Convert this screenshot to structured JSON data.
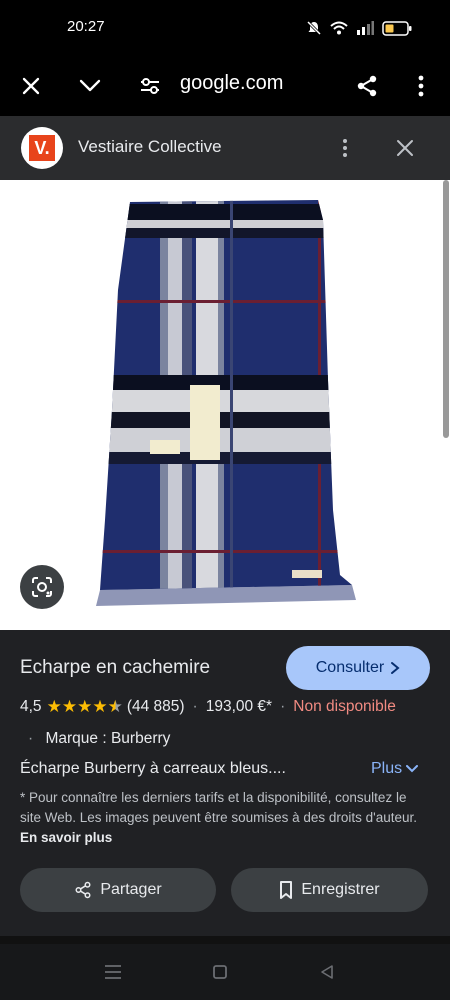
{
  "status_bar": {
    "time": "20:27",
    "icons": [
      "mute-icon",
      "wifi-icon",
      "signal-icon",
      "battery-icon"
    ],
    "battery_color": "#f9c74f"
  },
  "browser": {
    "url": "google.com",
    "icons": [
      "close-icon",
      "chevron-down-icon",
      "site-settings-icon",
      "share-icon",
      "more-vert-icon"
    ]
  },
  "site": {
    "logo_letter": "V.",
    "name": "Vestiaire Collective",
    "icons": [
      "more-vert-icon",
      "close-icon"
    ]
  },
  "image": {
    "lens_icon": "google-lens-icon"
  },
  "product": {
    "title": "Echarpe en cachemire",
    "consult_label": "Consulter",
    "rating": "4,5",
    "stars": 4.5,
    "reviews": "(44 885)",
    "price": "193,00 €*",
    "availability": "Non disponible",
    "brand": "Marque : Burberry",
    "description": "Écharpe Burberry à carreaux bleus....",
    "more_label": "Plus",
    "disclaimer": "* Pour connaître les derniers tarifs et la disponibilité, consultez le site Web. Les images peuvent être soumises à des droits d'auteur.",
    "learn_more": "En savoir plus",
    "share_label": "Partager",
    "save_label": "Enregistrer"
  },
  "colors": {
    "accent": "#a8c7fa",
    "link": "#8ab4f8",
    "unavailable": "#f28b82",
    "star": "#fbbc04",
    "panel": "#202124"
  },
  "nav": {
    "icons": [
      "menu-icon",
      "home-icon",
      "back-icon"
    ]
  }
}
